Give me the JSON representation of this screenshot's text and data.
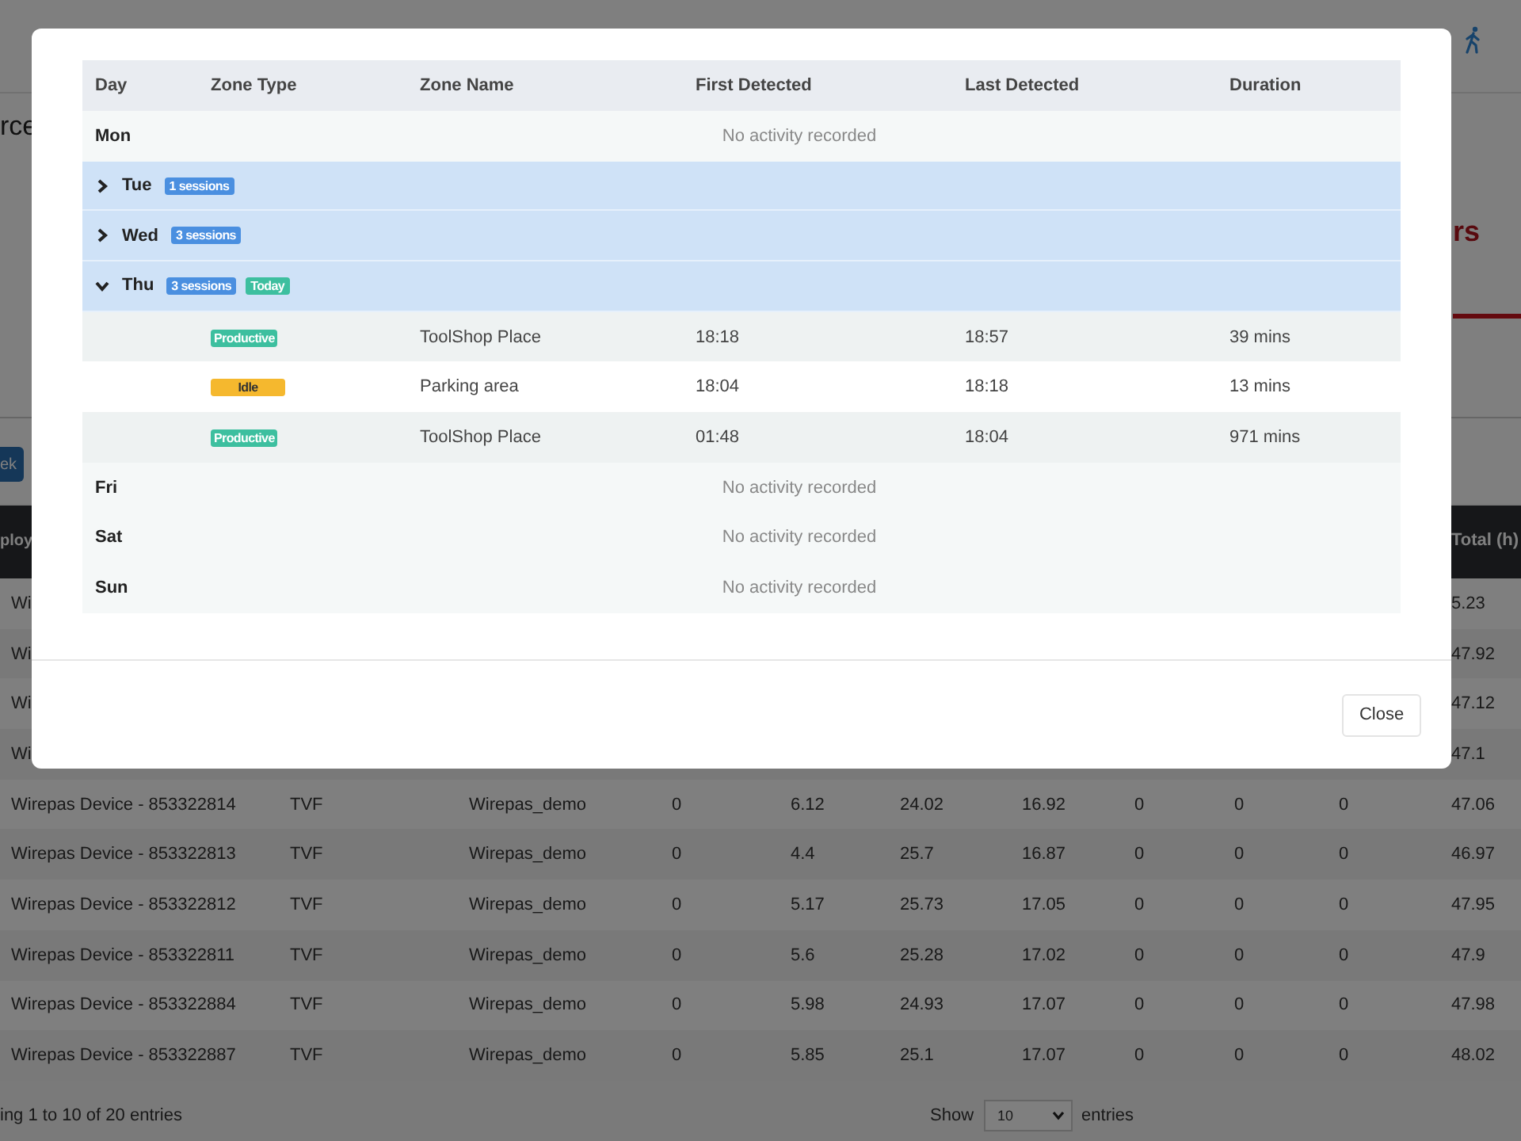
{
  "page": {
    "title_fragment": "rce",
    "heading_fragment": "rs",
    "week_button_fragment": "ek"
  },
  "table": {
    "header": {
      "first": "ploy",
      "total": "Total (h)"
    },
    "rows": [
      {
        "cells": [
          "Wi"
        ],
        "total": "5.23"
      },
      {
        "cells": [
          "Wi"
        ],
        "total": "47.92"
      },
      {
        "cells": [
          "Wi"
        ],
        "total": "47.12"
      },
      {
        "cells": [
          "Wi"
        ],
        "total": "47.1"
      },
      {
        "cells": [
          "Wirepas Device - 853322814",
          "TVF",
          "Wirepas_demo",
          "0",
          "6.12",
          "24.02",
          "16.92",
          "0",
          "0",
          "0"
        ],
        "total": "47.06"
      },
      {
        "cells": [
          "Wirepas Device - 853322813",
          "TVF",
          "Wirepas_demo",
          "0",
          "4.4",
          "25.7",
          "16.87",
          "0",
          "0",
          "0"
        ],
        "total": "46.97"
      },
      {
        "cells": [
          "Wirepas Device - 853322812",
          "TVF",
          "Wirepas_demo",
          "0",
          "5.17",
          "25.73",
          "17.05",
          "0",
          "0",
          "0"
        ],
        "total": "47.95"
      },
      {
        "cells": [
          "Wirepas Device - 853322811",
          "TVF",
          "Wirepas_demo",
          "0",
          "5.6",
          "25.28",
          "17.02",
          "0",
          "0",
          "0"
        ],
        "total": "47.9"
      },
      {
        "cells": [
          "Wirepas Device - 853322884",
          "TVF",
          "Wirepas_demo",
          "0",
          "5.98",
          "24.93",
          "17.07",
          "0",
          "0",
          "0"
        ],
        "total": "47.98"
      },
      {
        "cells": [
          "Wirepas Device - 853322887",
          "TVF",
          "Wirepas_demo",
          "0",
          "5.85",
          "25.1",
          "17.07",
          "0",
          "0",
          "0"
        ],
        "total": "48.02"
      }
    ]
  },
  "footer": {
    "info": "ing 1 to 10 of 20 entries",
    "show": "Show",
    "page_size": "10",
    "entries": "entries"
  },
  "modal": {
    "columns": [
      "Day",
      "Zone Type",
      "Zone Name",
      "First Detected",
      "Last Detected",
      "Duration"
    ],
    "days": [
      {
        "day": "Mon",
        "kind": "empty",
        "note": "No activity recorded"
      },
      {
        "day": "Tue",
        "kind": "group",
        "expanded": false,
        "badges": [
          {
            "text": "1 sessions",
            "kind": "count"
          }
        ]
      },
      {
        "day": "Wed",
        "kind": "group",
        "expanded": false,
        "badges": [
          {
            "text": "3 sessions",
            "kind": "count"
          }
        ]
      },
      {
        "day": "Thu",
        "kind": "group",
        "expanded": true,
        "badges": [
          {
            "text": "3 sessions",
            "kind": "count"
          },
          {
            "text": "Today",
            "kind": "today"
          }
        ],
        "sessions": [
          {
            "zone_type": "Productive",
            "kind": "productive",
            "zone_name": "ToolShop Place",
            "first": "18:18",
            "last": "18:57",
            "duration": "39 mins"
          },
          {
            "zone_type": "Idle",
            "kind": "idle",
            "zone_name": "Parking area",
            "first": "18:04",
            "last": "18:18",
            "duration": "13 mins"
          },
          {
            "zone_type": "Productive",
            "kind": "productive",
            "zone_name": "ToolShop Place",
            "first": "01:48",
            "last": "18:04",
            "duration": "971 mins"
          }
        ]
      },
      {
        "day": "Fri",
        "kind": "empty",
        "note": "No activity recorded"
      },
      {
        "day": "Sat",
        "kind": "empty",
        "note": "No activity recorded"
      },
      {
        "day": "Sun",
        "kind": "empty",
        "note": "No activity recorded"
      }
    ],
    "close": "Close"
  }
}
